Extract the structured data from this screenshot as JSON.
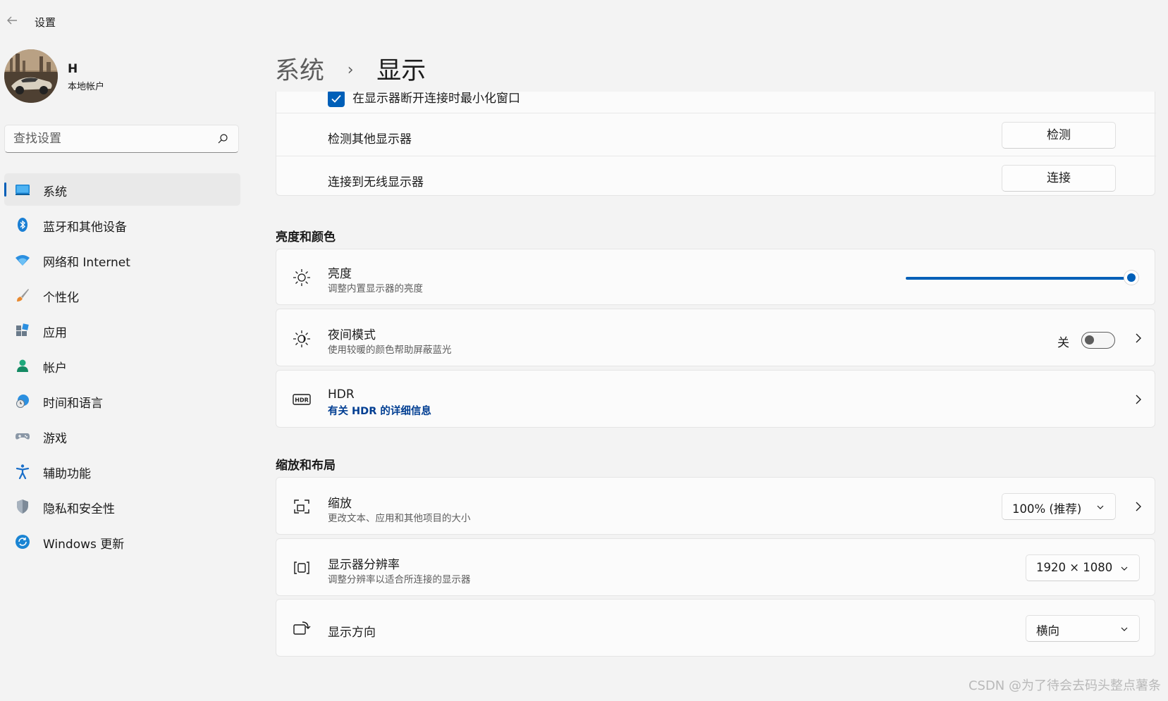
{
  "window": {
    "title": "设置"
  },
  "user": {
    "name": "H",
    "account_type": "本地帐户"
  },
  "search": {
    "placeholder": "查找设置"
  },
  "sidebar": {
    "items": [
      {
        "label": "系统",
        "icon": "system-icon",
        "active": true
      },
      {
        "label": "蓝牙和其他设备",
        "icon": "bluetooth-icon"
      },
      {
        "label": "网络和 Internet",
        "icon": "wifi-icon"
      },
      {
        "label": "个性化",
        "icon": "brush-icon"
      },
      {
        "label": "应用",
        "icon": "apps-icon"
      },
      {
        "label": "帐户",
        "icon": "account-icon"
      },
      {
        "label": "时间和语言",
        "icon": "clock-globe-icon"
      },
      {
        "label": "游戏",
        "icon": "gamepad-icon"
      },
      {
        "label": "辅助功能",
        "icon": "accessibility-icon"
      },
      {
        "label": "隐私和安全性",
        "icon": "shield-icon"
      },
      {
        "label": "Windows 更新",
        "icon": "update-icon"
      }
    ]
  },
  "breadcrumb": {
    "parent": "系统",
    "current": "显示"
  },
  "multi_display": {
    "minimize_checkbox_label": "在显示器断开连接时最小化窗口",
    "minimize_checked": true,
    "detect_label": "检测其他显示器",
    "detect_button": "检测",
    "wireless_label": "连接到无线显示器",
    "wireless_button": "连接"
  },
  "brightness_color": {
    "section_title": "亮度和颜色",
    "brightness": {
      "title": "亮度",
      "subtitle": "调整内置显示器的亮度",
      "value_fraction": 0.97
    },
    "night_light": {
      "title": "夜间模式",
      "subtitle": "使用较暖的颜色帮助屏蔽蓝光",
      "state_label": "关",
      "on": false
    },
    "hdr": {
      "title": "HDR",
      "link": "有关 HDR 的详细信息"
    }
  },
  "scale_layout": {
    "section_title": "缩放和布局",
    "scale": {
      "title": "缩放",
      "subtitle": "更改文本、应用和其他项目的大小",
      "value": "100% (推荐)"
    },
    "resolution": {
      "title": "显示器分辨率",
      "subtitle": "调整分辨率以适合所连接的显示器",
      "value": "1920 × 1080"
    },
    "orientation": {
      "title": "显示方向",
      "value": "横向"
    }
  },
  "watermark": "CSDN @为了待会去码头整点薯条",
  "colors": {
    "accent": "#005fb8",
    "link": "#003e92",
    "background": "#f3f3f3",
    "card": "#fbfbfb"
  }
}
